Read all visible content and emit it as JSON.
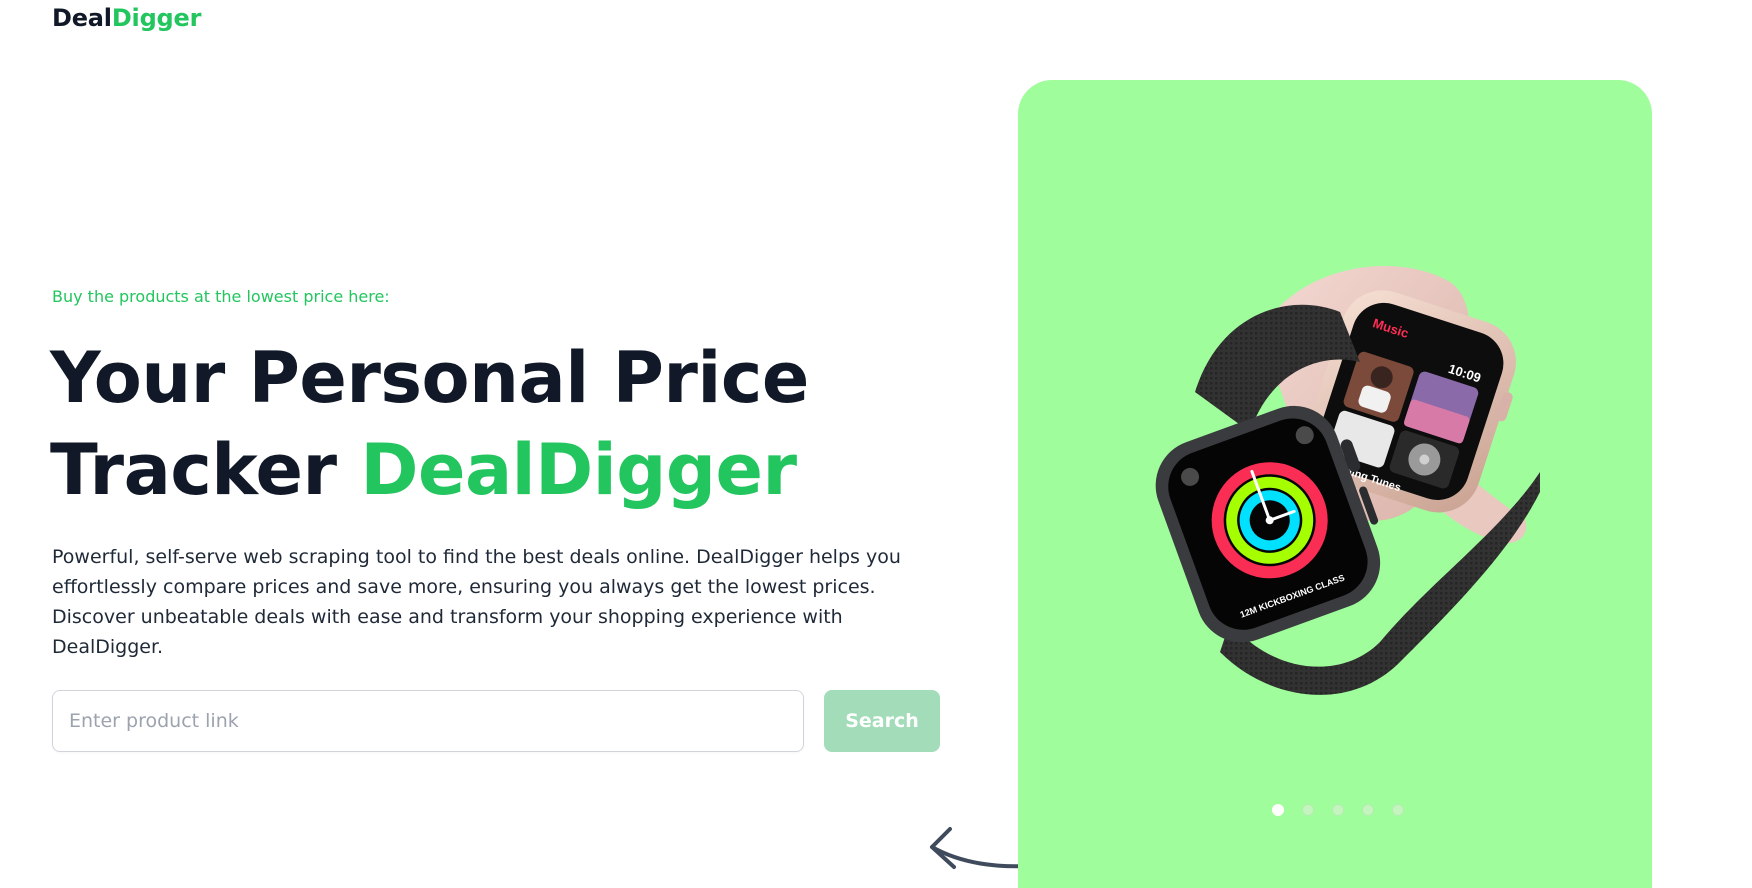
{
  "brand": {
    "name_part1": "Deal",
    "name_part2": "Digger",
    "accent_color": "#22c55e"
  },
  "hero": {
    "kicker": "Buy the products at the lowest price here:",
    "headline_part1": "Your Personal Price Tracker ",
    "headline_accent": "DealDigger",
    "description": "Powerful, self-serve web scraping tool to find the best deals online. DealDigger helps you effortlessly compare prices and save more, ensuring you always get the lowest prices. Discover unbeatable deals with ease and transform your shopping experience with DealDigger."
  },
  "search": {
    "value": "",
    "placeholder": "Enter product link",
    "button_label": "Search"
  },
  "carousel": {
    "background_color": "#a0fd9c",
    "product_image": "apple-watch-pair",
    "watch_screen": {
      "music_label": "Music",
      "time": "10:09",
      "track": "Running Tunes",
      "workout": "12M KICKBOXING CLASS"
    },
    "slide_count": 5,
    "active_slide": 1
  }
}
